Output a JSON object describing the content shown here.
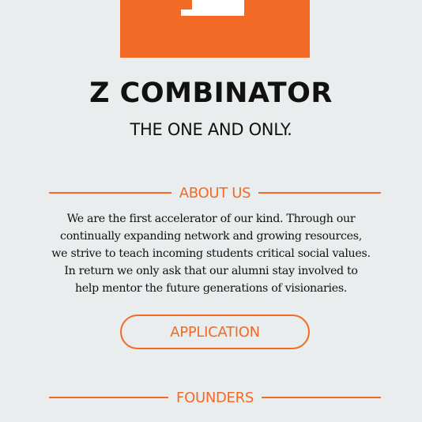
{
  "header": {
    "logo_icon": "z-logo-icon",
    "title": "Z COMBINATOR",
    "tagline": "THE ONE AND ONLY."
  },
  "about": {
    "heading": "ABOUT US",
    "lines": [
      "We are the first accelerator of our kind. Through our",
      "continually expanding network and growing resources,",
      "we strive to teach incoming students critical social values.",
      "In return we only ask that our alumni stay involved to",
      "help mentor the future generations of visionaries."
    ],
    "button_label": "APPLICATION"
  },
  "founders": {
    "heading": "FOUNDERS"
  },
  "colors": {
    "accent": "#f36a26",
    "background": "#e9eded",
    "text": "#111111"
  }
}
